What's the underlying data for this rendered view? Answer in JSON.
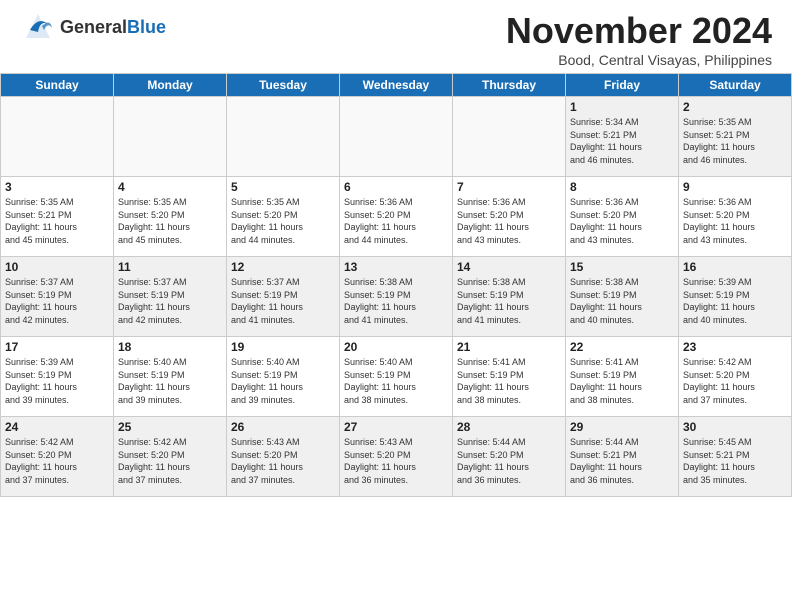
{
  "header": {
    "logo_general": "General",
    "logo_blue": "Blue",
    "month_title": "November 2024",
    "location": "Bood, Central Visayas, Philippines"
  },
  "weekdays": [
    "Sunday",
    "Monday",
    "Tuesday",
    "Wednesday",
    "Thursday",
    "Friday",
    "Saturday"
  ],
  "weeks": [
    [
      {
        "day": "",
        "info": "",
        "empty": true
      },
      {
        "day": "",
        "info": "",
        "empty": true
      },
      {
        "day": "",
        "info": "",
        "empty": true
      },
      {
        "day": "",
        "info": "",
        "empty": true
      },
      {
        "day": "",
        "info": "",
        "empty": true
      },
      {
        "day": "1",
        "info": "Sunrise: 5:34 AM\nSunset: 5:21 PM\nDaylight: 11 hours\nand 46 minutes."
      },
      {
        "day": "2",
        "info": "Sunrise: 5:35 AM\nSunset: 5:21 PM\nDaylight: 11 hours\nand 46 minutes."
      }
    ],
    [
      {
        "day": "3",
        "info": "Sunrise: 5:35 AM\nSunset: 5:21 PM\nDaylight: 11 hours\nand 45 minutes."
      },
      {
        "day": "4",
        "info": "Sunrise: 5:35 AM\nSunset: 5:20 PM\nDaylight: 11 hours\nand 45 minutes."
      },
      {
        "day": "5",
        "info": "Sunrise: 5:35 AM\nSunset: 5:20 PM\nDaylight: 11 hours\nand 44 minutes."
      },
      {
        "day": "6",
        "info": "Sunrise: 5:36 AM\nSunset: 5:20 PM\nDaylight: 11 hours\nand 44 minutes."
      },
      {
        "day": "7",
        "info": "Sunrise: 5:36 AM\nSunset: 5:20 PM\nDaylight: 11 hours\nand 43 minutes."
      },
      {
        "day": "8",
        "info": "Sunrise: 5:36 AM\nSunset: 5:20 PM\nDaylight: 11 hours\nand 43 minutes."
      },
      {
        "day": "9",
        "info": "Sunrise: 5:36 AM\nSunset: 5:20 PM\nDaylight: 11 hours\nand 43 minutes."
      }
    ],
    [
      {
        "day": "10",
        "info": "Sunrise: 5:37 AM\nSunset: 5:19 PM\nDaylight: 11 hours\nand 42 minutes."
      },
      {
        "day": "11",
        "info": "Sunrise: 5:37 AM\nSunset: 5:19 PM\nDaylight: 11 hours\nand 42 minutes."
      },
      {
        "day": "12",
        "info": "Sunrise: 5:37 AM\nSunset: 5:19 PM\nDaylight: 11 hours\nand 41 minutes."
      },
      {
        "day": "13",
        "info": "Sunrise: 5:38 AM\nSunset: 5:19 PM\nDaylight: 11 hours\nand 41 minutes."
      },
      {
        "day": "14",
        "info": "Sunrise: 5:38 AM\nSunset: 5:19 PM\nDaylight: 11 hours\nand 41 minutes."
      },
      {
        "day": "15",
        "info": "Sunrise: 5:38 AM\nSunset: 5:19 PM\nDaylight: 11 hours\nand 40 minutes."
      },
      {
        "day": "16",
        "info": "Sunrise: 5:39 AM\nSunset: 5:19 PM\nDaylight: 11 hours\nand 40 minutes."
      }
    ],
    [
      {
        "day": "17",
        "info": "Sunrise: 5:39 AM\nSunset: 5:19 PM\nDaylight: 11 hours\nand 39 minutes."
      },
      {
        "day": "18",
        "info": "Sunrise: 5:40 AM\nSunset: 5:19 PM\nDaylight: 11 hours\nand 39 minutes."
      },
      {
        "day": "19",
        "info": "Sunrise: 5:40 AM\nSunset: 5:19 PM\nDaylight: 11 hours\nand 39 minutes."
      },
      {
        "day": "20",
        "info": "Sunrise: 5:40 AM\nSunset: 5:19 PM\nDaylight: 11 hours\nand 38 minutes."
      },
      {
        "day": "21",
        "info": "Sunrise: 5:41 AM\nSunset: 5:19 PM\nDaylight: 11 hours\nand 38 minutes."
      },
      {
        "day": "22",
        "info": "Sunrise: 5:41 AM\nSunset: 5:19 PM\nDaylight: 11 hours\nand 38 minutes."
      },
      {
        "day": "23",
        "info": "Sunrise: 5:42 AM\nSunset: 5:20 PM\nDaylight: 11 hours\nand 37 minutes."
      }
    ],
    [
      {
        "day": "24",
        "info": "Sunrise: 5:42 AM\nSunset: 5:20 PM\nDaylight: 11 hours\nand 37 minutes."
      },
      {
        "day": "25",
        "info": "Sunrise: 5:42 AM\nSunset: 5:20 PM\nDaylight: 11 hours\nand 37 minutes."
      },
      {
        "day": "26",
        "info": "Sunrise: 5:43 AM\nSunset: 5:20 PM\nDaylight: 11 hours\nand 37 minutes."
      },
      {
        "day": "27",
        "info": "Sunrise: 5:43 AM\nSunset: 5:20 PM\nDaylight: 11 hours\nand 36 minutes."
      },
      {
        "day": "28",
        "info": "Sunrise: 5:44 AM\nSunset: 5:20 PM\nDaylight: 11 hours\nand 36 minutes."
      },
      {
        "day": "29",
        "info": "Sunrise: 5:44 AM\nSunset: 5:21 PM\nDaylight: 11 hours\nand 36 minutes."
      },
      {
        "day": "30",
        "info": "Sunrise: 5:45 AM\nSunset: 5:21 PM\nDaylight: 11 hours\nand 35 minutes."
      }
    ]
  ]
}
